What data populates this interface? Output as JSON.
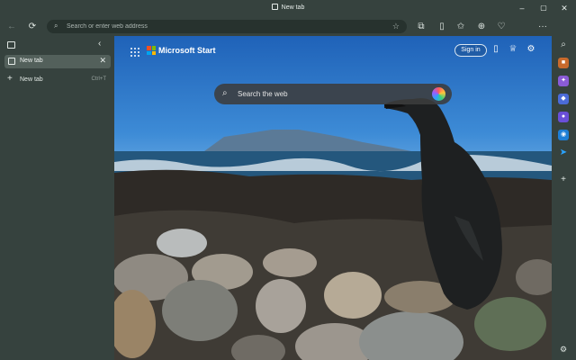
{
  "window": {
    "title": "New tab"
  },
  "window_controls": {
    "minimize": "–",
    "maximize": "▢",
    "close": "✕"
  },
  "toolbar": {
    "back": "←",
    "refresh": "⟳",
    "address_placeholder": "Search or enter web address",
    "more": "···"
  },
  "tabs_sidebar": {
    "active_tab": {
      "label": "New tab",
      "close": "✕"
    },
    "new_tab": {
      "label": "New tab",
      "shortcut": "Ctrl+T"
    }
  },
  "newtab_page": {
    "brand": "Microsoft Start",
    "sign_in": "Sign in",
    "search_placeholder": "Search the web"
  },
  "colors": {
    "frame": "#36423e",
    "address_bar": "#27322e",
    "active_tab": "#53605b",
    "ms_red": "#f25022",
    "ms_green": "#7fba00",
    "ms_blue": "#00a4ef",
    "ms_yellow": "#ffb900"
  }
}
